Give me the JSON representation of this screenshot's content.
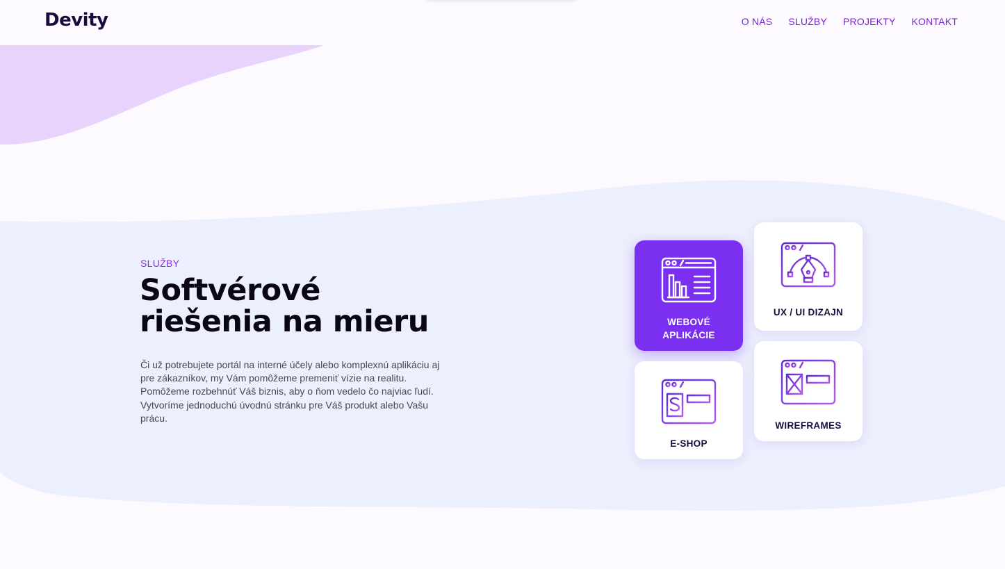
{
  "brand": {
    "logo": "Devity"
  },
  "nav": {
    "items": [
      "O NÁS",
      "SLUŽBY",
      "PROJEKTY",
      "KONTAKT"
    ]
  },
  "services": {
    "section_label": "SLUŽBY",
    "headline_line1": "Softvérové",
    "headline_line2": "riešenia na mieru",
    "description": "Či už potrebujete portál na interné účely alebo komplexnú aplikáciu aj pre zákazníkov, my Vám pomôžeme premeniť vízie na realitu. Pomôžeme rozbehnúť Váš biznis, aby o ňom vedelo čo najviac ľudí. Vytvoríme jednoduchú úvodnú stránku pre Váš produkt alebo Vašu prácu.",
    "cards": [
      {
        "label": "WEBOVÉ APLIKÁCIE",
        "icon": "browser-chart-icon",
        "active": true
      },
      {
        "label": "UX / UI DIZAJN",
        "icon": "browser-pen-tool-icon",
        "active": false
      },
      {
        "label": "E-SHOP",
        "icon": "browser-dollar-icon",
        "active": false
      },
      {
        "label": "WIREFRAMES",
        "icon": "browser-wireframe-icon",
        "active": false
      }
    ]
  },
  "colors": {
    "accent": "#7b2ff0",
    "nav_link": "#7b1fd6",
    "blob_purple": "#e8d3fd",
    "band_lavender": "#eceffd",
    "text_dark": "#0b0614"
  }
}
